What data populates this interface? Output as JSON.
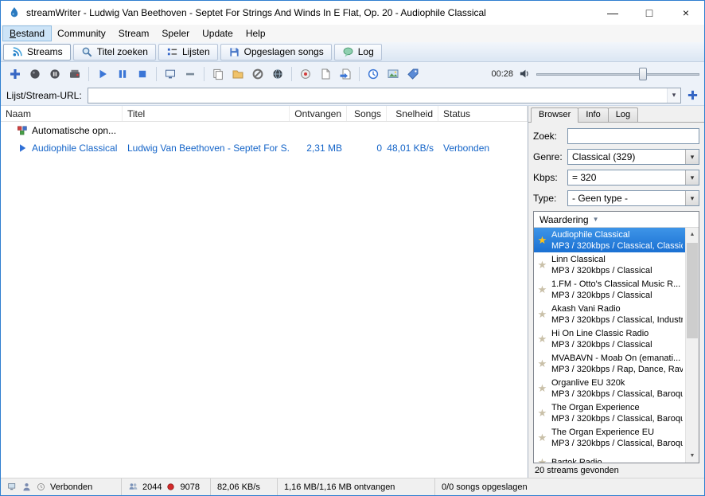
{
  "window": {
    "title": "streamWriter - Ludwig Van Beethoven - Septet For Strings And Winds In E Flat, Op. 20 - Audiophile Classical",
    "controls": {
      "minimize": "—",
      "maximize": "□",
      "close": "×"
    }
  },
  "menu": {
    "items": [
      "Bestand",
      "Community",
      "Stream",
      "Speler",
      "Update",
      "Help"
    ],
    "active": "Bestand"
  },
  "main_tabs": {
    "items": [
      "Streams",
      "Titel zoeken",
      "Lijsten",
      "Opgeslagen songs",
      "Log"
    ],
    "selected": "Streams"
  },
  "toolbar": {
    "time": "00:28"
  },
  "url_row": {
    "label": "Lijst/Stream-URL:",
    "value": ""
  },
  "stream_table": {
    "columns": [
      "Naam",
      "Titel",
      "Ontvangen",
      "Songs",
      "Snelheid",
      "Status"
    ],
    "rows": [
      {
        "naam": "Automatische opn...",
        "titel": "",
        "ontvangen": "",
        "songs": "",
        "snelheid": "",
        "status": ""
      },
      {
        "naam": "Audiophile Classical",
        "titel": "Ludwig Van Beethoven - Septet For S...",
        "ontvangen": "2,31 MB",
        "songs": "0",
        "snelheid": "48,01 KB/s",
        "status": "Verbonden"
      }
    ]
  },
  "browser_panel": {
    "tabs": [
      "Browser",
      "Info",
      "Log"
    ],
    "selected_tab": "Browser",
    "search_label": "Zoek:",
    "search_value": "",
    "genre_label": "Genre:",
    "genre_value": "Classical (329)",
    "kbps_label": "Kbps:",
    "kbps_value": "= 320",
    "type_label": "Type:",
    "type_value": "- Geen type -",
    "sort_header": "Waardering",
    "streams": [
      {
        "name": "Audiophile Classical",
        "desc": "MP3 / 320kbps / Classical, Classica",
        "selected": true
      },
      {
        "name": "Linn Classical",
        "desc": "MP3 / 320kbps / Classical"
      },
      {
        "name": "1.FM - Otto's Classical Music R...",
        "desc": "MP3 / 320kbps / Classical"
      },
      {
        "name": "Akash Vani Radio",
        "desc": "MP3 / 320kbps / Classical, Industr"
      },
      {
        "name": "Hi On Line Classic Radio",
        "desc": "MP3 / 320kbps / Classical"
      },
      {
        "name": "MVABAVN - Moab On (emanati...",
        "desc": "MP3 / 320kbps / Rap, Dance, Rav"
      },
      {
        "name": "Organlive EU 320k",
        "desc": "MP3 / 320kbps / Classical, Baroqu"
      },
      {
        "name": "The Organ Experience",
        "desc": "MP3 / 320kbps / Classical, Baroqu"
      },
      {
        "name": "The Organ Experience EU",
        "desc": "MP3 / 320kbps / Classical, Baroqu"
      },
      {
        "name": "Bartok Radio",
        "desc": ""
      }
    ],
    "footer": "20 streams gevonden"
  },
  "status_bar": {
    "connection": "Verbonden",
    "clients": "2044",
    "streams_count": "9078",
    "speed": "82,06 KB/s",
    "received": "1,16 MB/1,16 MB ontvangen",
    "songs_saved": "0/0 songs opgeslagen"
  },
  "icons": {
    "dropdown_arrow": "▾",
    "sort_arrow": "▼",
    "star": "★",
    "scroll_up": "▲",
    "scroll_down": "▼"
  },
  "colors": {
    "accent_blue": "#1a70d2",
    "link_blue": "#1464c8",
    "star_gold": "#ffc318",
    "window_border": "#2f7fd0"
  }
}
